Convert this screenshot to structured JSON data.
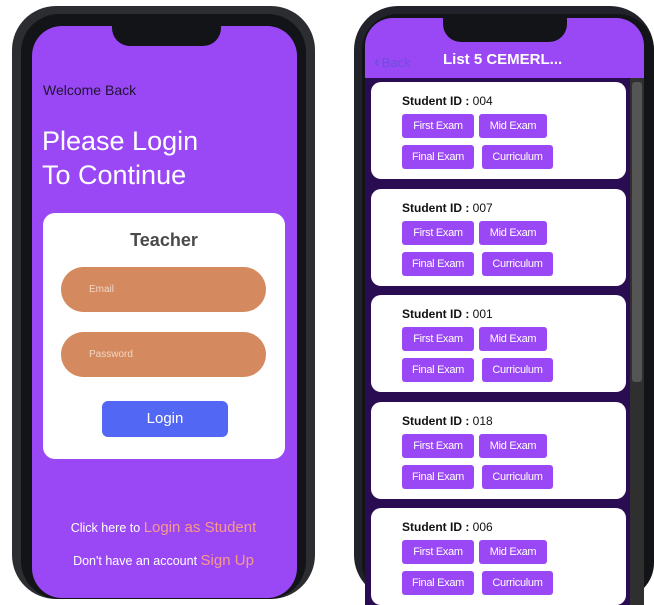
{
  "login_screen": {
    "welcome": "Welcome Back",
    "headline_line1": "Please Login",
    "headline_line2": "To Continue",
    "card_title": "Teacher",
    "email_placeholder": "Email",
    "password_placeholder": "Password",
    "login_button": "Login",
    "student_prompt": "Click here to",
    "student_link": "Login as Student",
    "signup_prompt": "Don't have an account",
    "signup_link": "Sign Up"
  },
  "list_screen": {
    "back_label": "Back",
    "title": "List 5 CEMERL...",
    "id_label": "Student ID :",
    "buttons": {
      "first": "First Exam",
      "mid": "Mid Exam",
      "final": "Final Exam",
      "curriculum": "Curriculum"
    },
    "students": [
      {
        "id": "004"
      },
      {
        "id": "007"
      },
      {
        "id": "001"
      },
      {
        "id": "018"
      },
      {
        "id": "006"
      }
    ]
  },
  "colors": {
    "purple": "#9a48f5",
    "email_field": "#d4895e",
    "login_button": "#5367f5",
    "link": "#f79a8a",
    "list_background": "#2a0c52"
  }
}
